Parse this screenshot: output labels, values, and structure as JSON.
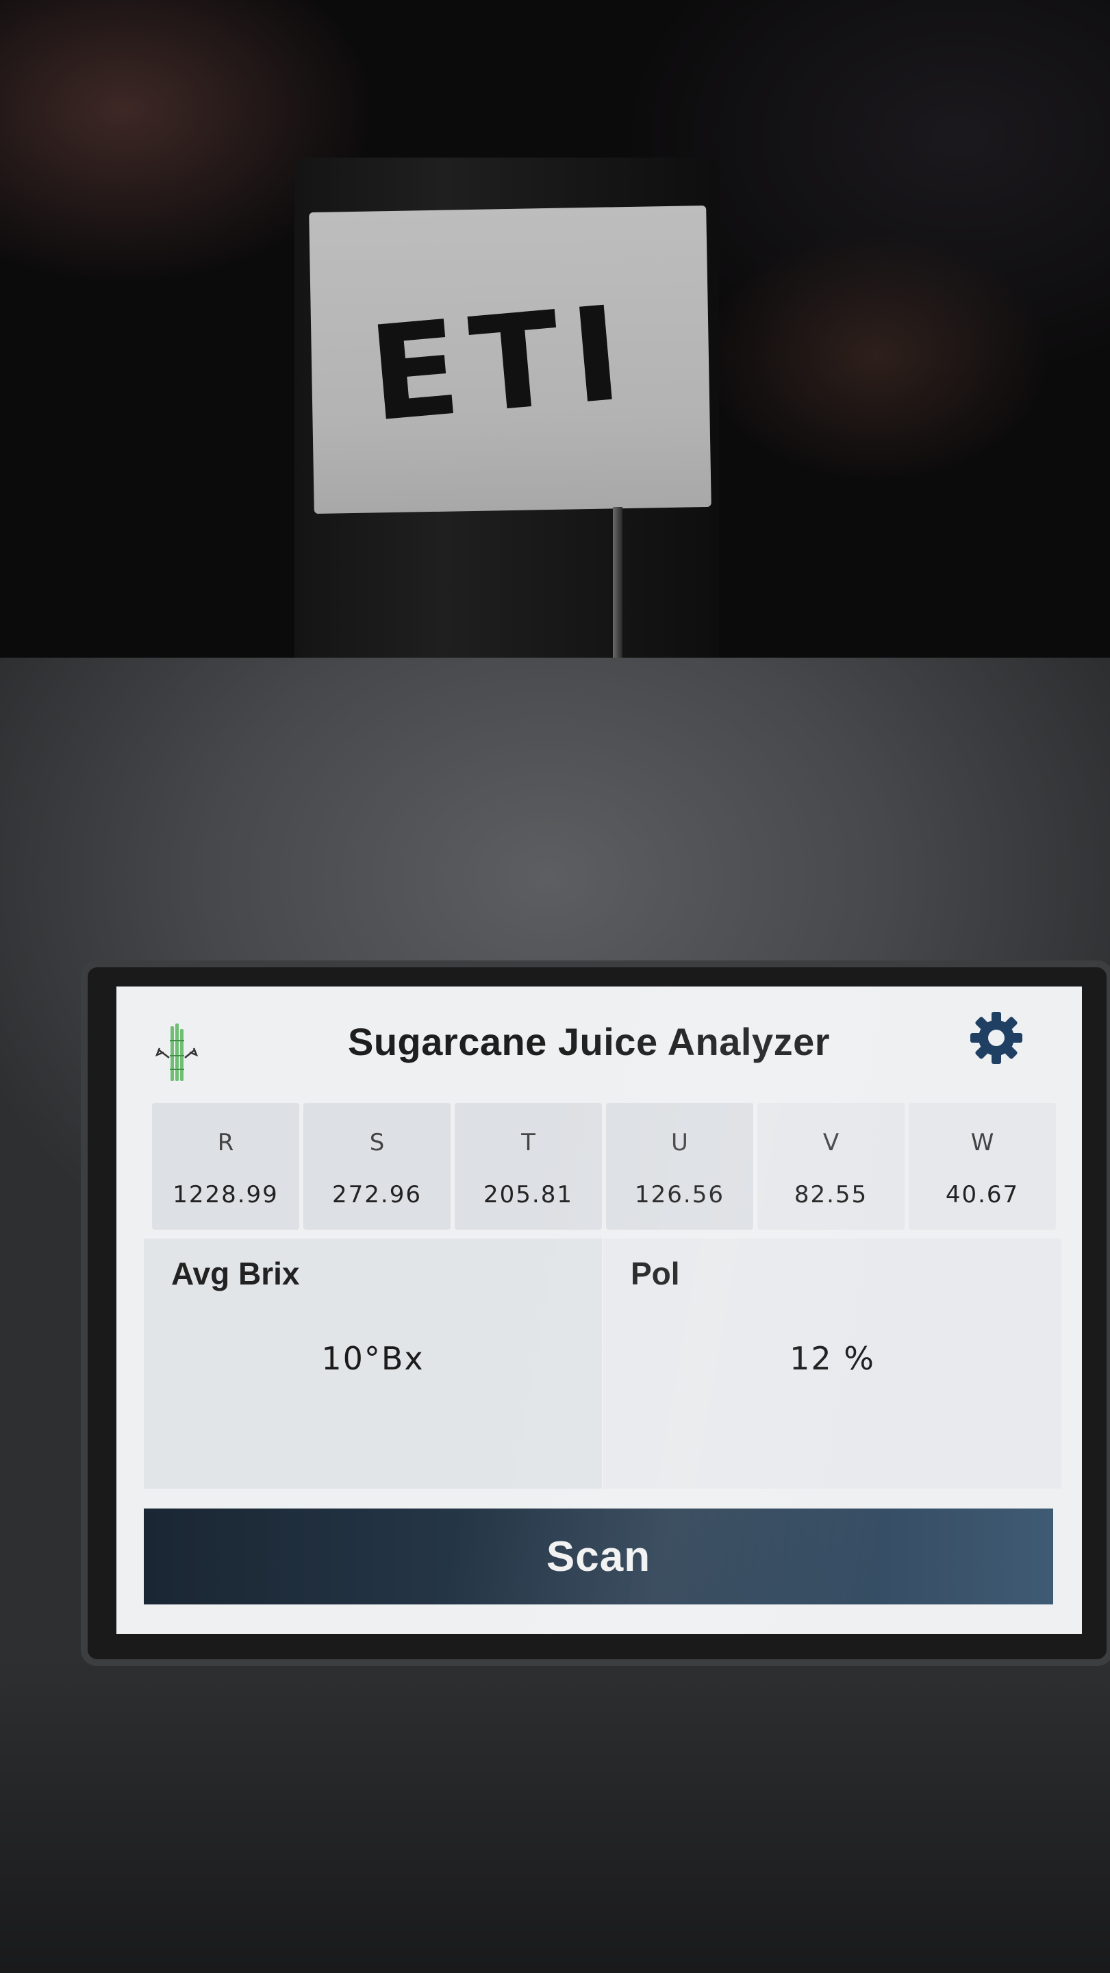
{
  "app": {
    "title": "Sugarcane Juice Analyzer",
    "logo_icon": "sugarcane-logo-icon",
    "settings_icon": "gear-icon"
  },
  "sample": {
    "tube_label": "ETI"
  },
  "channels": [
    {
      "name": "R",
      "value": "1228.99"
    },
    {
      "name": "S",
      "value": "272.96"
    },
    {
      "name": "T",
      "value": "205.81"
    },
    {
      "name": "U",
      "value": "126.56"
    },
    {
      "name": "V",
      "value": "82.55"
    },
    {
      "name": "W",
      "value": "40.67"
    }
  ],
  "results": {
    "brix_label": "Avg Brix",
    "brix_value": "10°Bx",
    "pol_label": "Pol",
    "pol_value": "12 %"
  },
  "actions": {
    "scan_label": "Scan"
  },
  "colors": {
    "logo_green": "#6fbf73",
    "scan_button": "#2b3f52",
    "screen_background": "#eef0f2"
  }
}
